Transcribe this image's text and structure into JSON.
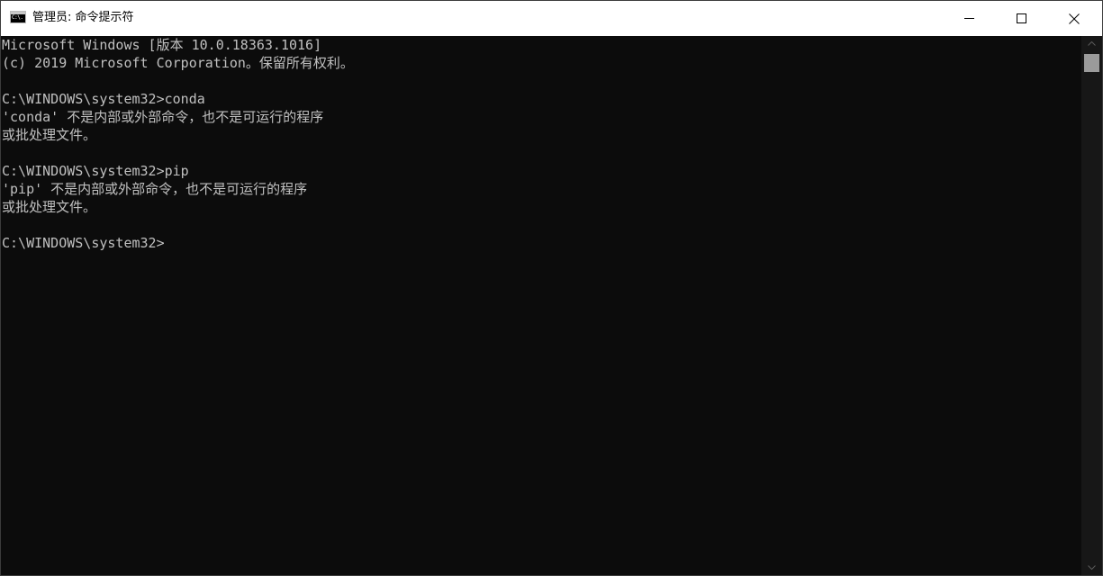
{
  "window": {
    "title": "管理员: 命令提示符"
  },
  "titlebar_buttons": {
    "minimize_icon": "minimize-icon",
    "maximize_icon": "maximize-icon",
    "close_icon": "close-icon"
  },
  "console": {
    "lines": [
      "Microsoft Windows [版本 10.0.18363.1016]",
      "(c) 2019 Microsoft Corporation。保留所有权利。",
      "",
      "C:\\WINDOWS\\system32>conda",
      "'conda' 不是内部或外部命令，也不是可运行的程序",
      "或批处理文件。",
      "",
      "C:\\WINDOWS\\system32>pip",
      "'pip' 不是内部或外部命令，也不是可运行的程序",
      "或批处理文件。",
      "",
      "C:\\WINDOWS\\system32>"
    ]
  },
  "colors": {
    "console_background": "#0c0c0c",
    "console_text": "#c0c0c0",
    "titlebar_background": "#ffffff"
  }
}
